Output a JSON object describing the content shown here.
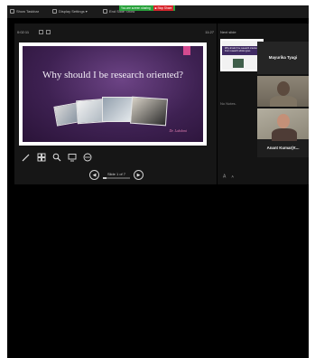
{
  "toolbar": {
    "items": [
      {
        "label": "Show Taskbar"
      },
      {
        "label": "Display Settings ▾"
      },
      {
        "label": "End Slide Show"
      }
    ],
    "share_status": "You are screen sharing",
    "stop_share_label": "■ Stop Share"
  },
  "presenter": {
    "timer": "0:02:11",
    "clock": "11:27",
    "slide": {
      "title": "Why should I be research oriented?",
      "signature": "Dr. Lakshmi"
    },
    "slide_counter": "Slide 1 of 7",
    "slide_progress": 0.14
  },
  "side": {
    "next_slide_label": "Next slide",
    "next_slide_thumb_text": "Why should I be research oriented? Four research article types",
    "notes_label": "No Notes."
  },
  "participants": [
    {
      "name": "Mayurika Tyagi"
    },
    {
      "name": ""
    },
    {
      "name": "Anant Kumar(K..."
    }
  ],
  "colors": {
    "background": "#000000",
    "slide_background": "#4a2a5e",
    "accent": "#d44a8f",
    "share_green": "#29a23c",
    "stop_red": "#d8262c"
  }
}
